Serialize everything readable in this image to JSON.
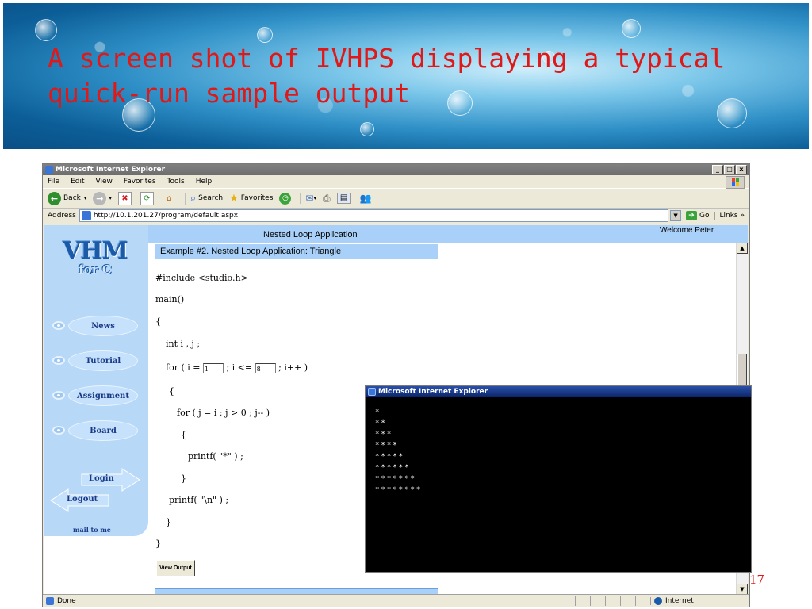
{
  "slide": {
    "title": "A screen shot of IVHPS displaying a typical quick-run sample output",
    "page_number": "17"
  },
  "browser": {
    "window_title": "Microsoft Internet Explorer",
    "window_buttons": [
      "_",
      "□",
      "x"
    ],
    "menu": [
      {
        "label": "File",
        "key": "F",
        "rest": "ile"
      },
      {
        "label": "Edit",
        "key": "E",
        "rest": "dit"
      },
      {
        "label": "View",
        "key": "V",
        "rest": "iew"
      },
      {
        "label": "Favorites",
        "key": "a",
        "rest": "vorites",
        "pre": "F"
      },
      {
        "label": "Tools",
        "key": "T",
        "rest": "ools"
      },
      {
        "label": "Help",
        "key": "H",
        "rest": "elp"
      }
    ],
    "toolbar": {
      "back": "Back",
      "search": "Search",
      "favorites": "Favorites"
    },
    "address": {
      "label": "Address",
      "url": "http://10.1.201.27/program/default.aspx",
      "go": "Go",
      "links": "Links"
    },
    "status": {
      "text": "Done",
      "zone": "Internet"
    }
  },
  "webpage": {
    "header_title": "Nested Loop Application",
    "welcome": "Welcome Peter",
    "logo": {
      "line1": "VHM",
      "line2": "for C"
    },
    "nav": [
      "News",
      "Tutorial",
      "Assignment",
      "Board"
    ],
    "login": "Login",
    "logout": "Logout",
    "mail": "mail to me",
    "example_title": "Example #2. Nested Loop Application: Triangle",
    "code": {
      "include": "#include <studio.h>",
      "main": "main()",
      "open1": "{",
      "decl": "int i , j ;",
      "for1_a": "for ( i =",
      "for1_b": "; i <=",
      "for1_c": "; i++ )",
      "i_start": "1",
      "i_end": "8",
      "open2": "{",
      "for2": "for ( j = i ; j > 0 ; j-- )",
      "open3": "{",
      "printf_star": "printf( \"*\" ) ;",
      "close3": "}",
      "printf_nl": "printf( \"\\n\" ) ;",
      "close2": "}",
      "close1": "}"
    },
    "view_output": "View Output"
  },
  "popup": {
    "title": "Microsoft Internet Explorer",
    "output": [
      "*",
      "**",
      "***",
      "****",
      "*****",
      "******",
      "*******",
      "********"
    ]
  },
  "colors": {
    "title_red": "#e01818",
    "page_header_blue": "#a8d0f8",
    "sidebar_blue": "#b8d8f8",
    "popup_titlebar": "#0a246a"
  }
}
